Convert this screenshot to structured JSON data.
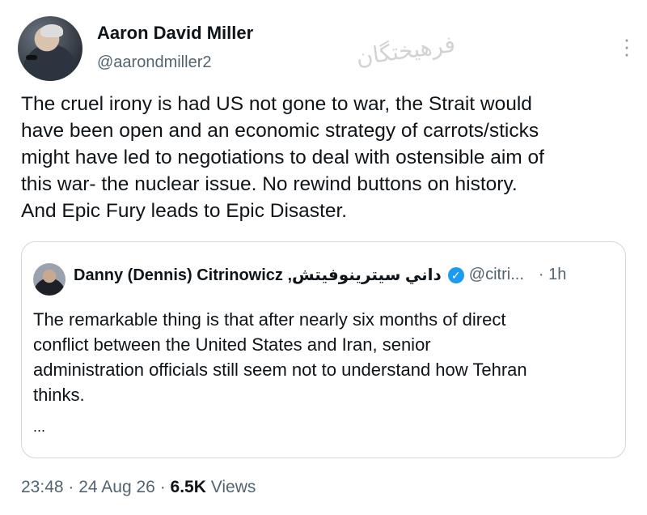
{
  "author": {
    "name": "Aaron David Miller",
    "handle": "@aarondmiller2"
  },
  "watermark": "فرهیختگان",
  "tweet_text": "The cruel irony is had US  not gone to war, the Strait would\nhave been open and an economic strategy of carrots/sticks\nmight have led to negotiations to deal with ostensible aim of\nthis war- the nuclear issue. No rewind buttons on history.\nAnd Epic Fury leads to Epic Disaster.",
  "quoted": {
    "name": "Danny (Dennis) Citrinowicz ,داني سيترينوفيتش",
    "handle": "@citri...",
    "time": "· 1h",
    "text": "The remarkable thing is that after nearly six months of direct\nconflict between the United States and Iran, senior\nadministration officials still seem not to understand how Tehran\nthinks.",
    "ellipsis": "...",
    "verified_color": "#1d9bf0"
  },
  "meta": {
    "time": "23:48",
    "date": "24 Aug 26",
    "views_count": "6.5K",
    "views_label": "Views",
    "separator": "·"
  },
  "icons": [
    "more-options-icon",
    "verified-badge-icon"
  ]
}
